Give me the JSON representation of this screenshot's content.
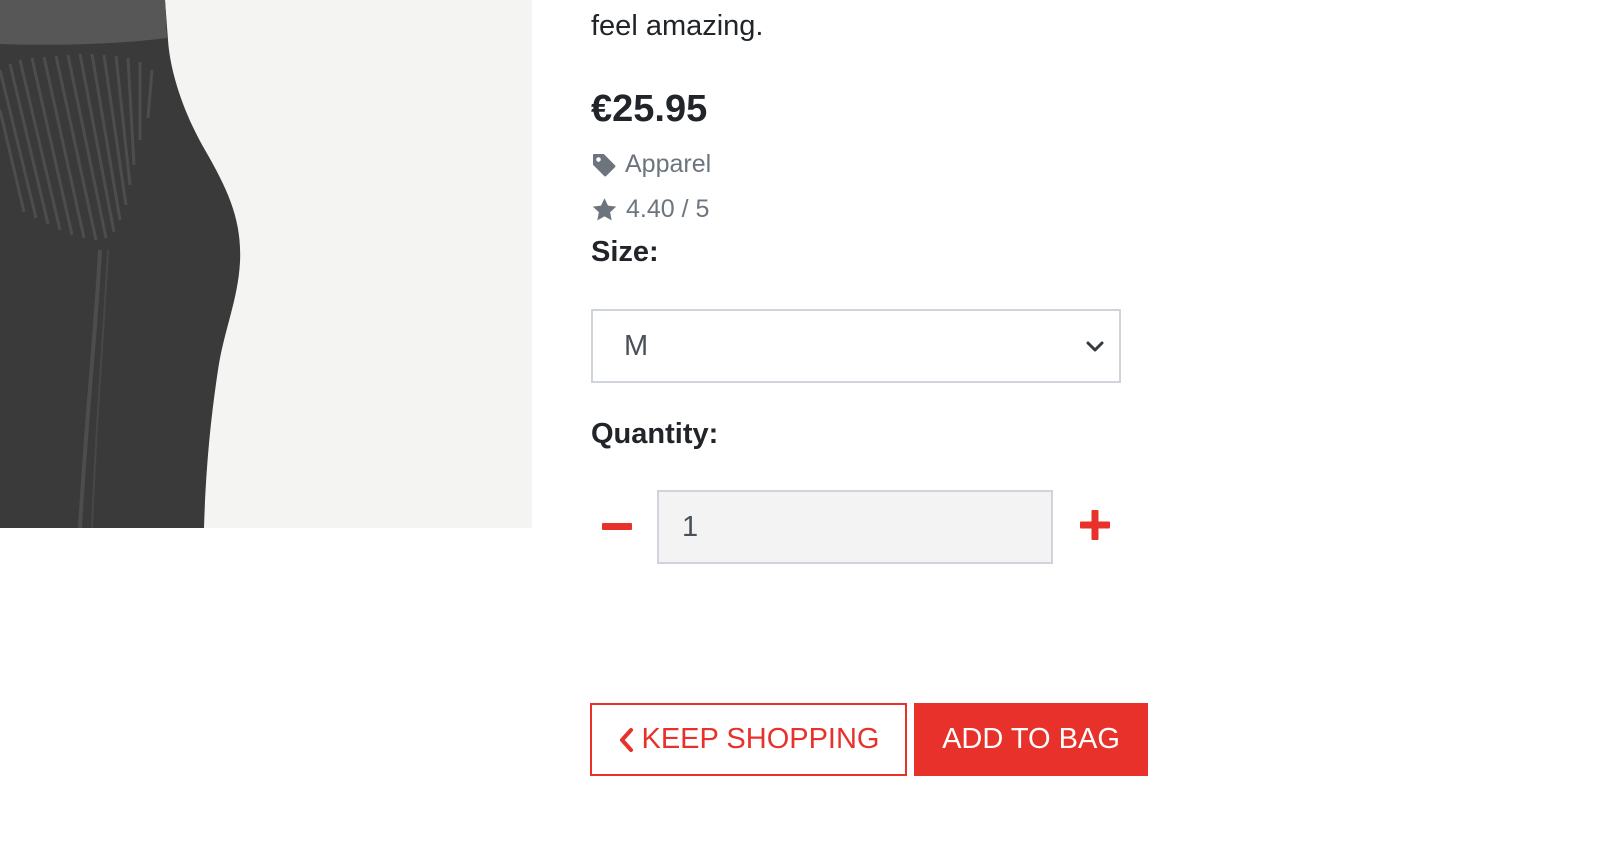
{
  "product": {
    "description_tail": "feel amazing.",
    "price": "€25.95",
    "category": "Apparel",
    "rating": "4.40 / 5"
  },
  "size": {
    "label": "Size:",
    "selected": "M"
  },
  "quantity": {
    "label": "Quantity:",
    "value": "1"
  },
  "actions": {
    "keep_shopping": "KEEP SHOPPING",
    "add_to_bag": "ADD TO BAG"
  },
  "icons": {
    "category": "tag-icon",
    "rating": "star-icon",
    "select": "chevron-down-icon",
    "decrease": "minus-icon",
    "increase": "plus-icon",
    "back": "chevron-left-icon"
  },
  "colors": {
    "accent": "#e8312a",
    "muted": "#6c757d",
    "text": "#212529"
  }
}
